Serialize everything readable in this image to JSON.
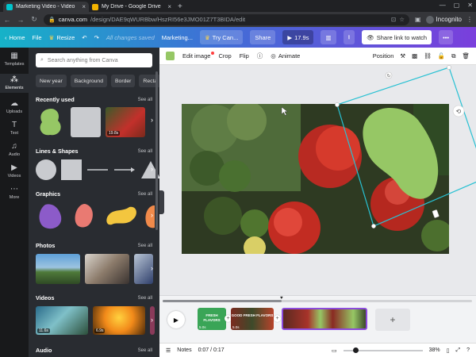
{
  "browser": {
    "tabs": [
      {
        "title": "Marketing Video - Video",
        "favicon_color": "#00c4cc",
        "active": true
      },
      {
        "title": "My Drive - Google Drive",
        "favicon_color": "#f4b400",
        "active": false
      }
    ],
    "url_host": "canva.com",
    "url_path": "/design/DAE9qWURBbw/HszRI56e3JMO01Z7T3BIDA/edit",
    "profile_label": "Incognito"
  },
  "header": {
    "home": "Home",
    "file": "File",
    "resize": "Resize",
    "saved_status": "All changes saved",
    "design_title": "Marketing...",
    "try_canva": "Try Can...",
    "share": "Share",
    "play_duration": "17.9s",
    "share_link": "Share link to watch"
  },
  "rail": {
    "items": [
      {
        "label": "Templates",
        "icon": "templates-icon"
      },
      {
        "label": "Elements",
        "icon": "elements-icon"
      },
      {
        "label": "Uploads",
        "icon": "uploads-icon"
      },
      {
        "label": "Text",
        "icon": "text-icon"
      },
      {
        "label": "Audio",
        "icon": "audio-icon"
      },
      {
        "label": "Videos",
        "icon": "videos-icon"
      },
      {
        "label": "More",
        "icon": "more-icon"
      }
    ]
  },
  "panel": {
    "search_placeholder": "Search anything from Canva",
    "chips": [
      "New year",
      "Background",
      "Border",
      "Recta"
    ],
    "see_all": "See all",
    "sections": {
      "recent": "Recently used",
      "lines": "Lines & Shapes",
      "graphics": "Graphics",
      "photos": "Photos",
      "videos": "Videos",
      "audio": "Audio"
    },
    "recent_duration": "19.8s",
    "video_durations": [
      "11.6s",
      "6.9s"
    ]
  },
  "toolbar": {
    "swatch_color": "#96c765",
    "edit_image": "Edit image",
    "crop": "Crop",
    "flip": "Flip",
    "animate": "Animate",
    "position": "Position"
  },
  "timeline": {
    "clips": [
      {
        "label": "FRESH FLAVORS",
        "duration": "5.0s"
      },
      {
        "label": "GOOD FRESH FLAVORS",
        "duration": "5.0s"
      },
      {
        "label": "",
        "duration": ""
      }
    ]
  },
  "footer": {
    "notes": "Notes",
    "time": "0:07 / 0:17",
    "zoom": "38%"
  },
  "colors": {
    "blob_green": "#96c765",
    "selection": "#28c1d3",
    "header_start": "#16b2c8",
    "header_end": "#7a3fdc"
  }
}
